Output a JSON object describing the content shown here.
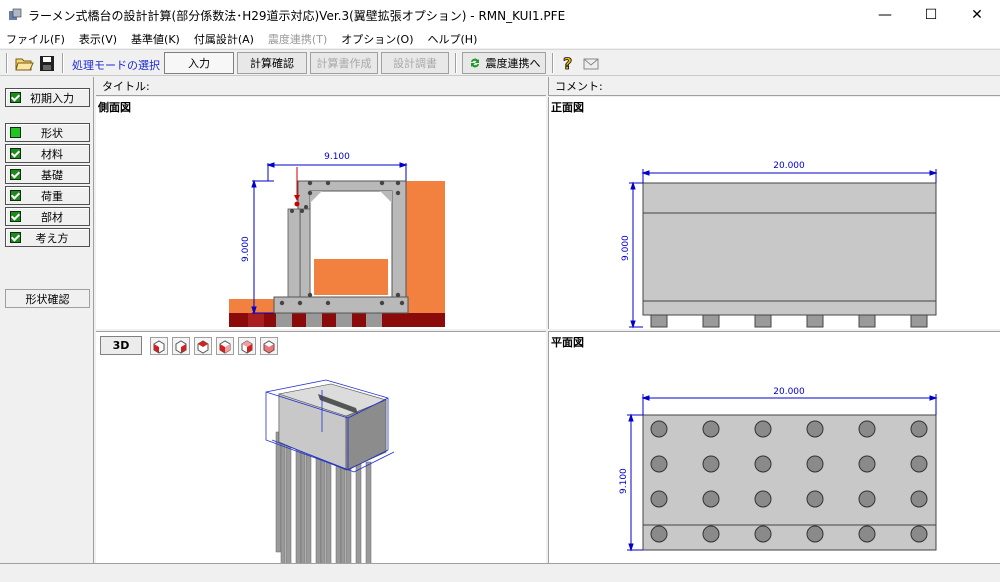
{
  "window": {
    "title": "ラーメン式橋台の設計計算(部分係数法･H29道示対応)Ver.3(翼壁拡張オプション) - RMN_KUI1.PFE",
    "minimize": "—",
    "maximize": "☐",
    "close": "✕"
  },
  "menu": [
    {
      "label": "ファイル(F)",
      "enabled": true
    },
    {
      "label": "表示(V)",
      "enabled": true
    },
    {
      "label": "基準値(K)",
      "enabled": true
    },
    {
      "label": "付属設計(A)",
      "enabled": true
    },
    {
      "label": "震度連携(T)",
      "enabled": false
    },
    {
      "label": "オプション(O)",
      "enabled": true
    },
    {
      "label": "ヘルプ(H)",
      "enabled": true
    }
  ],
  "toolbar": {
    "mode_label": "処理モードの選択",
    "input": "入力",
    "calc_check": "計算確認",
    "report_create": "計算書作成",
    "design_doc": "設計調書",
    "seismic_link": "震度連携へ"
  },
  "sidebar": {
    "initial_input": "初期入力",
    "items": [
      "形状",
      "材料",
      "基礎",
      "荷重",
      "部材",
      "考え方"
    ],
    "shape_check": "形状確認"
  },
  "headers": {
    "title_label": "タイトル:",
    "comment_label": "コメント:"
  },
  "panes": {
    "side_view": {
      "title": "側面図",
      "dim_width": "9.100",
      "dim_height": "9.000"
    },
    "front_view": {
      "title": "正面図",
      "dim_width": "20.000",
      "dim_height": "9.000"
    },
    "view3d": {
      "button": "3D"
    },
    "plan_view": {
      "title": "平面図",
      "dim_width": "20.000",
      "dim_height": "9.100"
    }
  },
  "colors": {
    "concrete": "#b9b9b9",
    "soil": "#f2803f",
    "pile_cap": "#8b0a0a",
    "dimension": "#0000cc",
    "load": "#cc0000"
  }
}
